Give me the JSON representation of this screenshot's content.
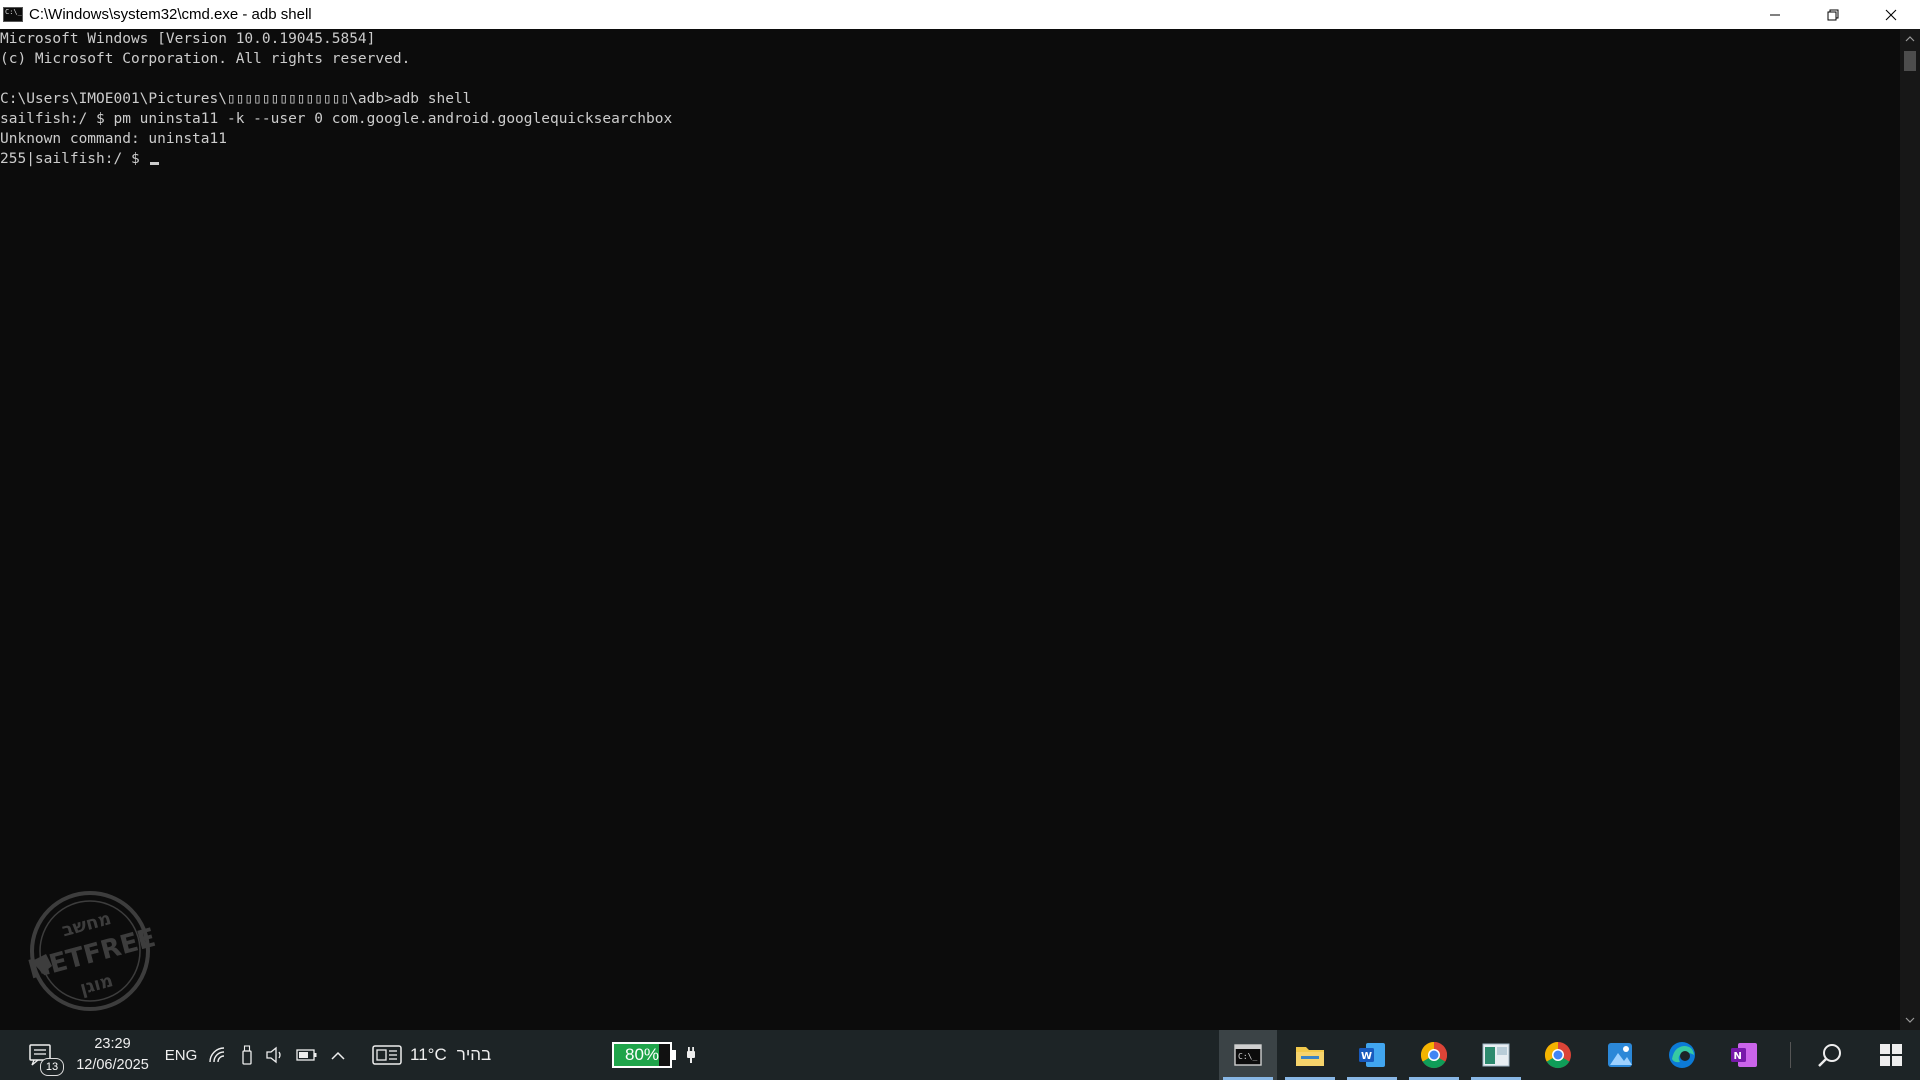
{
  "window": {
    "title": "C:\\Windows\\system32\\cmd.exe - adb  shell",
    "controls": {
      "minimize": "—",
      "restore": "❐",
      "close": "✕"
    }
  },
  "console": {
    "lines": [
      "Microsoft Windows [Version 10.0.19045.5854]",
      "(c) Microsoft Corporation. All rights reserved.",
      "",
      "C:\\Users\\IMOE001\\Pictures\\▯▯▯▯▯▯▯▯▯▯▯▯▯▯\\adb>adb shell",
      "sailfish:/ $ pm uninsta11 -k --user 0 com.google.android.googlequicksearchbox",
      "Unknown command: uninsta11",
      "255|sailfish:/ $ "
    ]
  },
  "watermark": {
    "top_text": "מחשב",
    "middle_text": "NETFREE",
    "bottom_text": "מוגן"
  },
  "taskbar": {
    "notification_count": "13",
    "clock": {
      "time": "23:29",
      "date": "12/06/2025"
    },
    "language": "ENG",
    "weather": {
      "temperature": "11°C",
      "condition": "בהיר"
    },
    "battery": {
      "label": "80%",
      "level": 80
    },
    "apps": [
      {
        "name": "command-prompt",
        "active": true
      },
      {
        "name": "file-explorer",
        "active": false
      },
      {
        "name": "word",
        "active": false
      },
      {
        "name": "chrome",
        "active": false
      },
      {
        "name": "app-window",
        "active": false
      },
      {
        "name": "chrome-2",
        "active": false
      },
      {
        "name": "photos",
        "active": false
      },
      {
        "name": "edge",
        "active": false
      },
      {
        "name": "onenote",
        "active": false
      }
    ]
  },
  "colors": {
    "console_bg": "#0c0c0c",
    "console_fg": "#cccccc",
    "taskbar_bg": "#1d2426",
    "battery_fill": "#1fa44a",
    "accent": "#88b7e5"
  }
}
